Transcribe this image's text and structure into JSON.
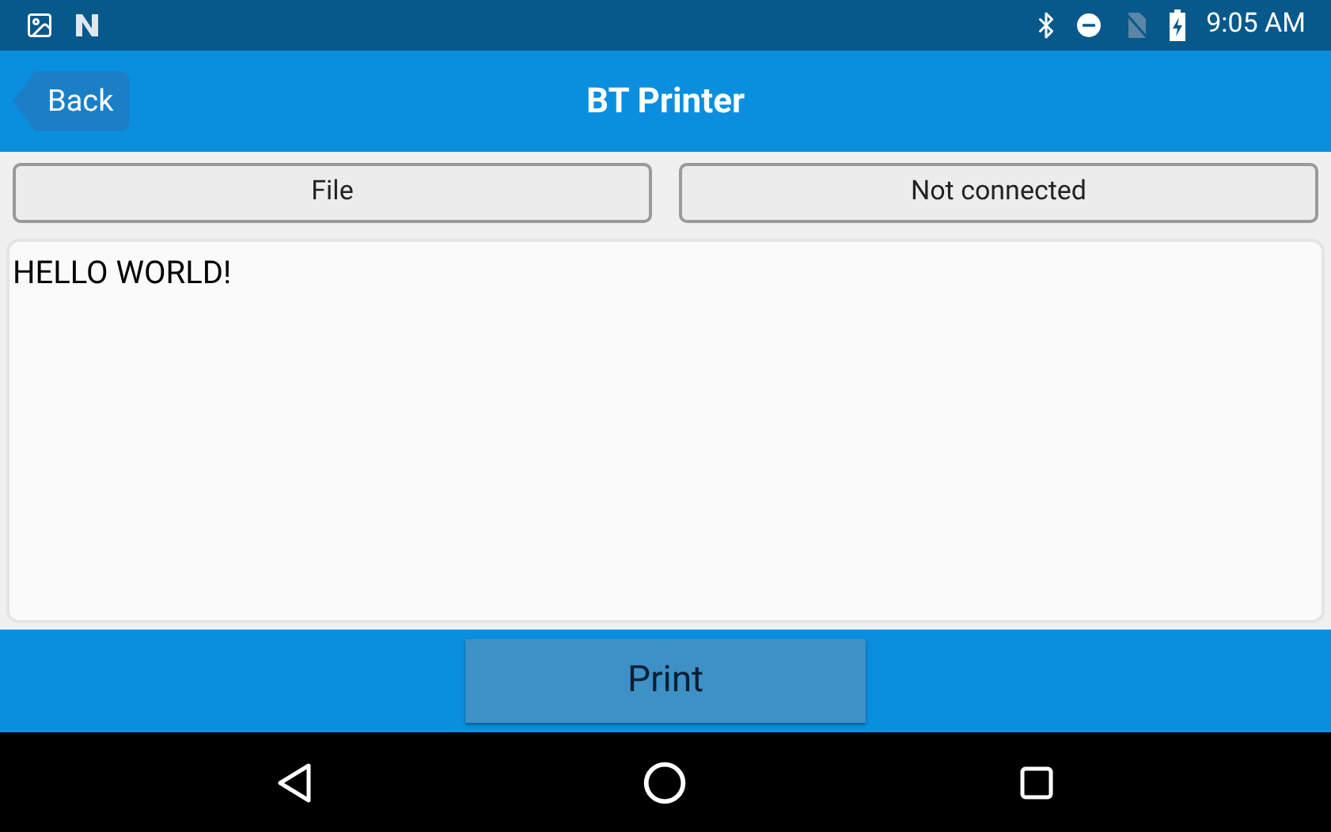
{
  "status_bar": {
    "time": "9:05 AM"
  },
  "header": {
    "back": "Back",
    "title": "BT Printer"
  },
  "buttons": [
    {
      "label": "File"
    },
    {
      "label": "Not connected"
    }
  ],
  "text_area": {
    "value": "HELLO WORLD!"
  },
  "print_button": {
    "label": "Print"
  }
}
